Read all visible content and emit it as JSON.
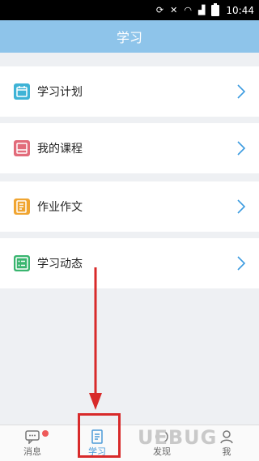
{
  "status_bar": {
    "time": "10:44",
    "icons": [
      "sync-icon",
      "silent-icon",
      "wifi-icon",
      "signal-icon",
      "battery-icon"
    ]
  },
  "header": {
    "title": "学习"
  },
  "menu": {
    "items": [
      {
        "label": "学习计划",
        "icon": "calendar-icon",
        "color": "#3eb3d6"
      },
      {
        "label": "我的课程",
        "icon": "book-icon",
        "color": "#e26b7a"
      },
      {
        "label": "作业作文",
        "icon": "homework-icon",
        "color": "#f0a531"
      },
      {
        "label": "学习动态",
        "icon": "activity-list-icon",
        "color": "#39b56f"
      }
    ]
  },
  "bottom_nav": {
    "tabs": [
      {
        "label": "消息",
        "icon": "message-icon",
        "badge": true
      },
      {
        "label": "学习",
        "icon": "study-icon",
        "active": true
      },
      {
        "label": "发现",
        "icon": "discover-icon"
      },
      {
        "label": "我",
        "icon": "profile-icon"
      }
    ]
  },
  "watermark": "UEBUG",
  "colors": {
    "header_bg": "#8ec4ea",
    "active_tab": "#4a9ad8",
    "annotation_red": "#d82a2a"
  }
}
